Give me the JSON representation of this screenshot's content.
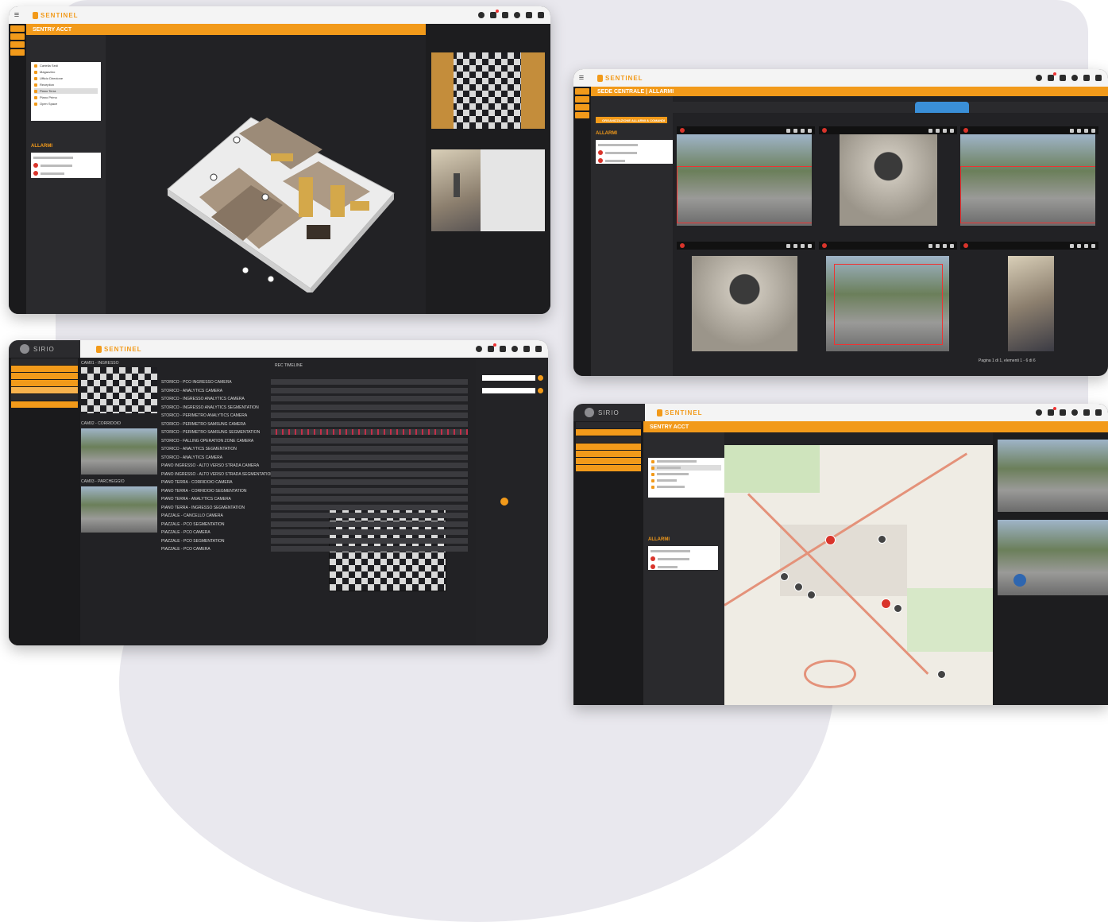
{
  "brand": {
    "app_name": "SENTINEL",
    "company": "SIRIO"
  },
  "screen_3d": {
    "header_title": "SENTRY ACCT",
    "tree": [
      "Cartella Sedi",
      "Magazzino",
      "Ufficio Direzione",
      "Reception",
      "Piano Terra",
      "Piano Primo",
      "Open Space"
    ],
    "alarms_title": "ALLARMI"
  },
  "screen_alarms": {
    "header_title": "SEDE CENTRALE | ALLARMI",
    "sub_header": "ORGANIZZAZIONE ALLARMI & COMANDI",
    "alarms_title": "ALLARMI",
    "pagination": "Pagina 1 di 1, elementi 1 - 6 di 6"
  },
  "screen_timeline": {
    "header": "REC TIMELINE",
    "cameras": [
      "CAM01 - INGRESSO",
      "CAM02 - CORRIDOIO",
      "CAM03 - PARCHEGGIO"
    ],
    "rows": [
      "STORICO - PCO INGRESSO CAMERA",
      "STORICO - ANALYTICS CAMERA",
      "STORICO - INGRESSO ANALYTICS CAMERA",
      "STORICO - INGRESSO ANALYTICS SEGMENTATION",
      "STORICO - PERIMETRO ANALYTICS CAMERA",
      "STORICO - PERIMETRO SAMSUNG CAMERA",
      "STORICO - PERIMETRO SAMSUNG SEGMENTATION",
      "STORICO - FALLING OPERATION ZONE CAMERA",
      "STORICO - ANALYTICS SEGMENTATION",
      "STORICO - ANALYTICS CAMERA",
      "PIANO INGRESSO - ALTO VERSO STRADA CAMERA",
      "PIANO INGRESSO - ALTO VERSO STRADA SEGMENTATION",
      "PIANO TERRA - CORRIDOIO CAMERA",
      "PIANO TERRA - CORRIDOIO SEGMENTATION",
      "PIANO TERRA - ANALYTICS CAMERA",
      "PIANO TERRA - INGRESSO SEGMENTATION",
      "PIAZZALE - CANCELLO CAMERA",
      "PIAZZALE - PCO SEGMENTATION",
      "PIAZZALE - PCO CAMERA",
      "PIAZZALE - PCO SEGMENTATION",
      "PIAZZALE - PCO CAMERA"
    ]
  },
  "screen_map": {
    "header_title": "SENTRY ACCT",
    "alarms_title": "ALLARMI"
  }
}
